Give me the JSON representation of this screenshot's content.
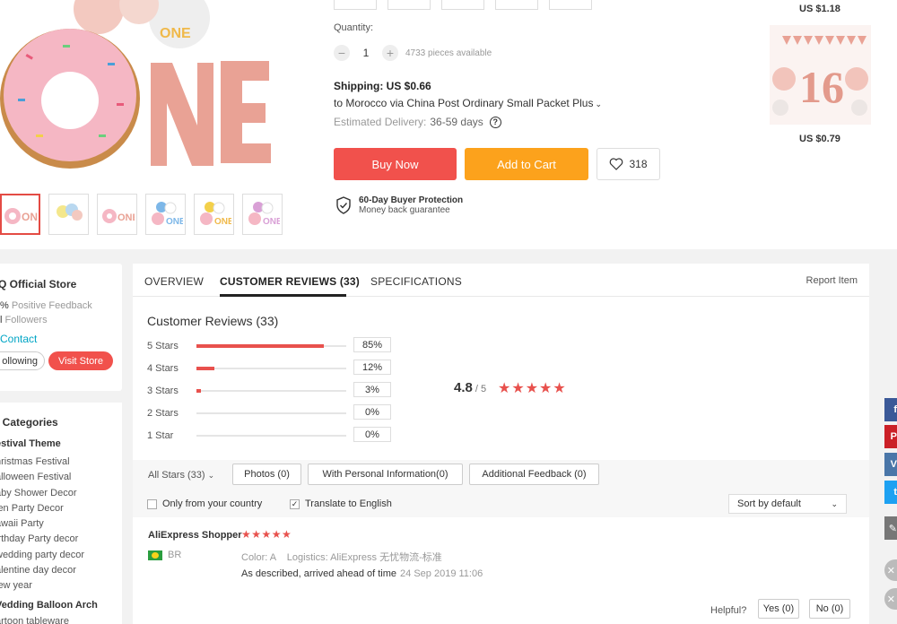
{
  "product": {
    "quantity_label": "Quantity:",
    "quantity_value": "1",
    "available": "4733 pieces available",
    "shipping_label": "Shipping:",
    "shipping_price": "US $0.66",
    "shipping_via": "to Morocco via China Post Ordinary Small Packet Plus",
    "eta_label": "Estimated Delivery:",
    "eta_value": "36-59 days",
    "buy_now": "Buy Now",
    "add_to_cart": "Add to Cart",
    "wish_count": "318",
    "protection_title": "60-Day Buyer Protection",
    "protection_sub": "Money back guarantee",
    "hero_text": "ONE"
  },
  "recommended": [
    {
      "price": "US $1.18"
    },
    {
      "price": "US $0.79",
      "number": "16"
    }
  ],
  "store": {
    "name": "Q Official Store",
    "feedback_value": "%",
    "feedback_label": "Positive Feedback",
    "followers_value": "l",
    "followers_label": "Followers",
    "contact": "Contact",
    "following": "ollowing",
    "visit": "Visit Store"
  },
  "categories": {
    "heading": "re Categories",
    "group1": "estival Theme",
    "items": [
      "hristmas Festival",
      "alloween Festival",
      "aby Shower Decor",
      "len Party Decor",
      "awaii Party",
      "irthday Party decor",
      "wedding party decor",
      "alentine day decor",
      "lew year"
    ],
    "group2": "Vedding Balloon Arch",
    "last": "artoon tableware"
  },
  "tabs": {
    "overview": "OVERVIEW",
    "reviews": "CUSTOMER REVIEWS (33)",
    "specifications": "SPECIFICATIONS",
    "report": "Report Item"
  },
  "reviews_summary": {
    "title": "Customer Reviews (33)",
    "rows": [
      {
        "label": "5 Stars",
        "pct": "85%",
        "fraction": 0.85
      },
      {
        "label": "4 Stars",
        "pct": "12%",
        "fraction": 0.12
      },
      {
        "label": "3 Stars",
        "pct": "3%",
        "fraction": 0.03
      },
      {
        "label": "2 Stars",
        "pct": "0%",
        "fraction": 0
      },
      {
        "label": "1 Star",
        "pct": "0%",
        "fraction": 0
      }
    ],
    "score": "4.8",
    "score_of": "/ 5",
    "stars": "★★★★★"
  },
  "filters": {
    "all_stars": "All Stars (33)",
    "photos": "Photos (0)",
    "personal": "With Personal Information(0)",
    "additional": "Additional Feedback (0)",
    "only_country": "Only from your country",
    "translate": "Translate to English",
    "sort": "Sort by default"
  },
  "review": {
    "user": "AliExpress Shopper",
    "stars": "★★★★★",
    "country": "BR",
    "color_label": "Color:",
    "color_value": "A",
    "logistics_label": "Logistics:",
    "logistics_value": "AliExpress 无忧物流-标准",
    "text": "As described, arrived ahead of time",
    "date": "24 Sep 2019 11:06",
    "helpful": "Helpful?",
    "yes": "Yes (0)",
    "no": "No (0)"
  },
  "share": [
    "f",
    "P",
    "V",
    "t"
  ],
  "colors": {
    "accent": "#f1514c",
    "cart": "#fca21c",
    "link": "#00a5c5"
  }
}
